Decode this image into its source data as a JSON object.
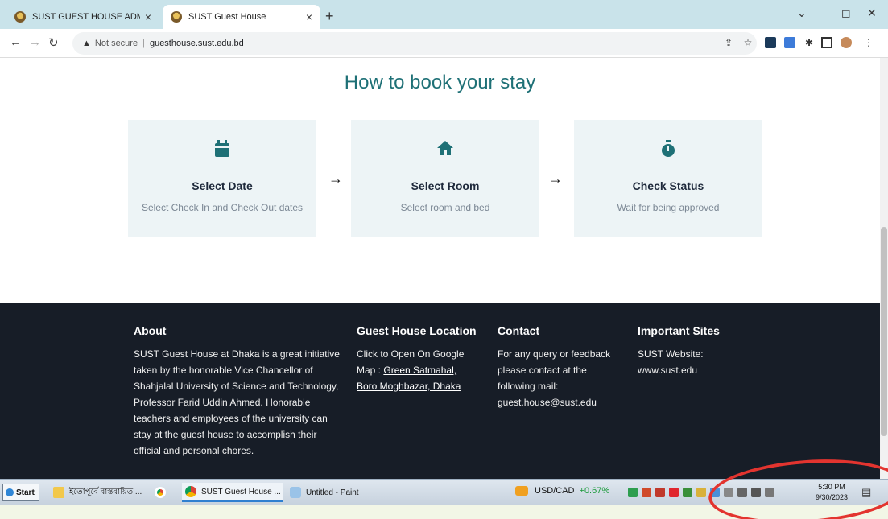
{
  "browser": {
    "tabs": [
      {
        "label": "SUST GUEST HOUSE ADMIN",
        "active": false
      },
      {
        "label": "SUST Guest House",
        "active": true
      }
    ],
    "new_tab": "+",
    "close_glyph": "×",
    "security_label": "Not secure",
    "url": "guesthouse.sust.edu.bd",
    "window_controls": {
      "chevron": "⌄",
      "minimize": "–",
      "maximize": "◻",
      "close": "✕"
    }
  },
  "page": {
    "heading": "How to book your stay",
    "steps": [
      {
        "title": "Select Date",
        "subtitle": "Select Check In and Check Out dates",
        "icon": "calendar-icon"
      },
      {
        "title": "Select Room",
        "subtitle": "Select room and bed",
        "icon": "home-icon"
      },
      {
        "title": "Check Status",
        "subtitle": "Wait for being approved",
        "icon": "stopwatch-icon"
      }
    ],
    "step_arrow": "→",
    "accent_color": "#1e7076"
  },
  "footer": {
    "about": {
      "title": "About",
      "text": "SUST Guest House at Dhaka is a great initiative taken by the honorable Vice Chancellor of Shahjalal University of Science and Technology, Professor Farid Uddin Ahmed. Honorable teachers and employees of the university can stay at the guest house to accomplish their official and personal chores."
    },
    "location": {
      "title": "Guest House Location",
      "text": "Click to Open On Google Map : ",
      "link": "Green Satmahal, Boro Moghbazar, Dhaka"
    },
    "contact": {
      "title": "Contact",
      "text": "For any query or feedback please contact at the following mail: guest.house@sust.edu"
    },
    "sites": {
      "title": "Important Sites",
      "text": "SUST Website: www.sust.edu"
    }
  },
  "taskbar": {
    "start": "Start",
    "tasks": [
      "ইতোপূর্বে বাস্তবায়িত ...",
      "SUST Guest House ...",
      "Untitled - Paint"
    ],
    "ticker_label": "USD/CAD",
    "ticker_value": "+0.67%",
    "time": "5:30 PM",
    "date": "9/30/2023"
  }
}
